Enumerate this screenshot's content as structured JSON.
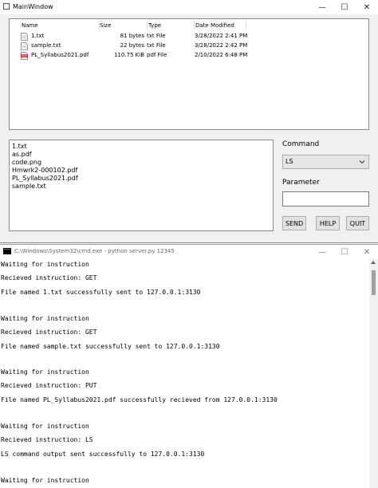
{
  "main_window": {
    "title": "MainWindow",
    "controls": {
      "minimize": "—",
      "maximize": "☐",
      "close": "✕"
    },
    "file_table": {
      "headers": [
        "Name",
        "Size",
        "Type",
        "Date Modified"
      ],
      "rows": [
        {
          "name": "1.txt",
          "size": "81 bytes",
          "type": "txt File",
          "date": "3/28/2022 2:41 PM",
          "icon": "txt-file-icon"
        },
        {
          "name": "sample.txt",
          "size": "22 bytes",
          "type": "txt File",
          "date": "3/28/2022 2:42 PM",
          "icon": "txt-file-icon"
        },
        {
          "name": "PL_Syllabus2021.pdf",
          "size": "110.75 KiB",
          "type": "pdf File",
          "date": "2/10/2022 6:48 PM",
          "icon": "pdf-file-icon"
        }
      ]
    },
    "output_list": [
      "1.txt",
      "as.pdf",
      "code.png",
      "Hmwrk2-000102.pdf",
      "PL_Syllabus2021.pdf",
      "sample.txt"
    ],
    "command_label": "Command",
    "command_value": "LS",
    "parameter_label": "Parameter",
    "parameter_value": "",
    "buttons": {
      "send": "SEND",
      "help": "HELP",
      "quit": "QUIT"
    },
    "pdf_icon_text": "PDF"
  },
  "console_window": {
    "title": "C:\\Windows\\System32\\cmd.exe - python  server.py 12345",
    "lines": [
      "Waiting for instruction",
      "Recieved instruction: GET",
      "File named 1.txt successfully sent to 127.0.0.1:3130",
      "Waiting for instruction",
      "Recieved instruction: GET",
      "File named sample.txt successfully sent to 127.0.0.1:3130",
      "Waiting for instruction",
      "Recieved instruction: PUT",
      "File named PL_Syllabus2021.pdf successfully recieved from 127.0.0.1:3130",
      "Waiting for instruction",
      "Recieved instruction: LS",
      "LS command output sent successfully to 127.0.0.1:3130",
      "Waiting for instruction"
    ]
  },
  "colors": {
    "window_bg": "#f0f0f0",
    "panel_border": "#8a8a8a",
    "pdf_red": "#d6232b",
    "button_bg": "#e1e1e1"
  }
}
